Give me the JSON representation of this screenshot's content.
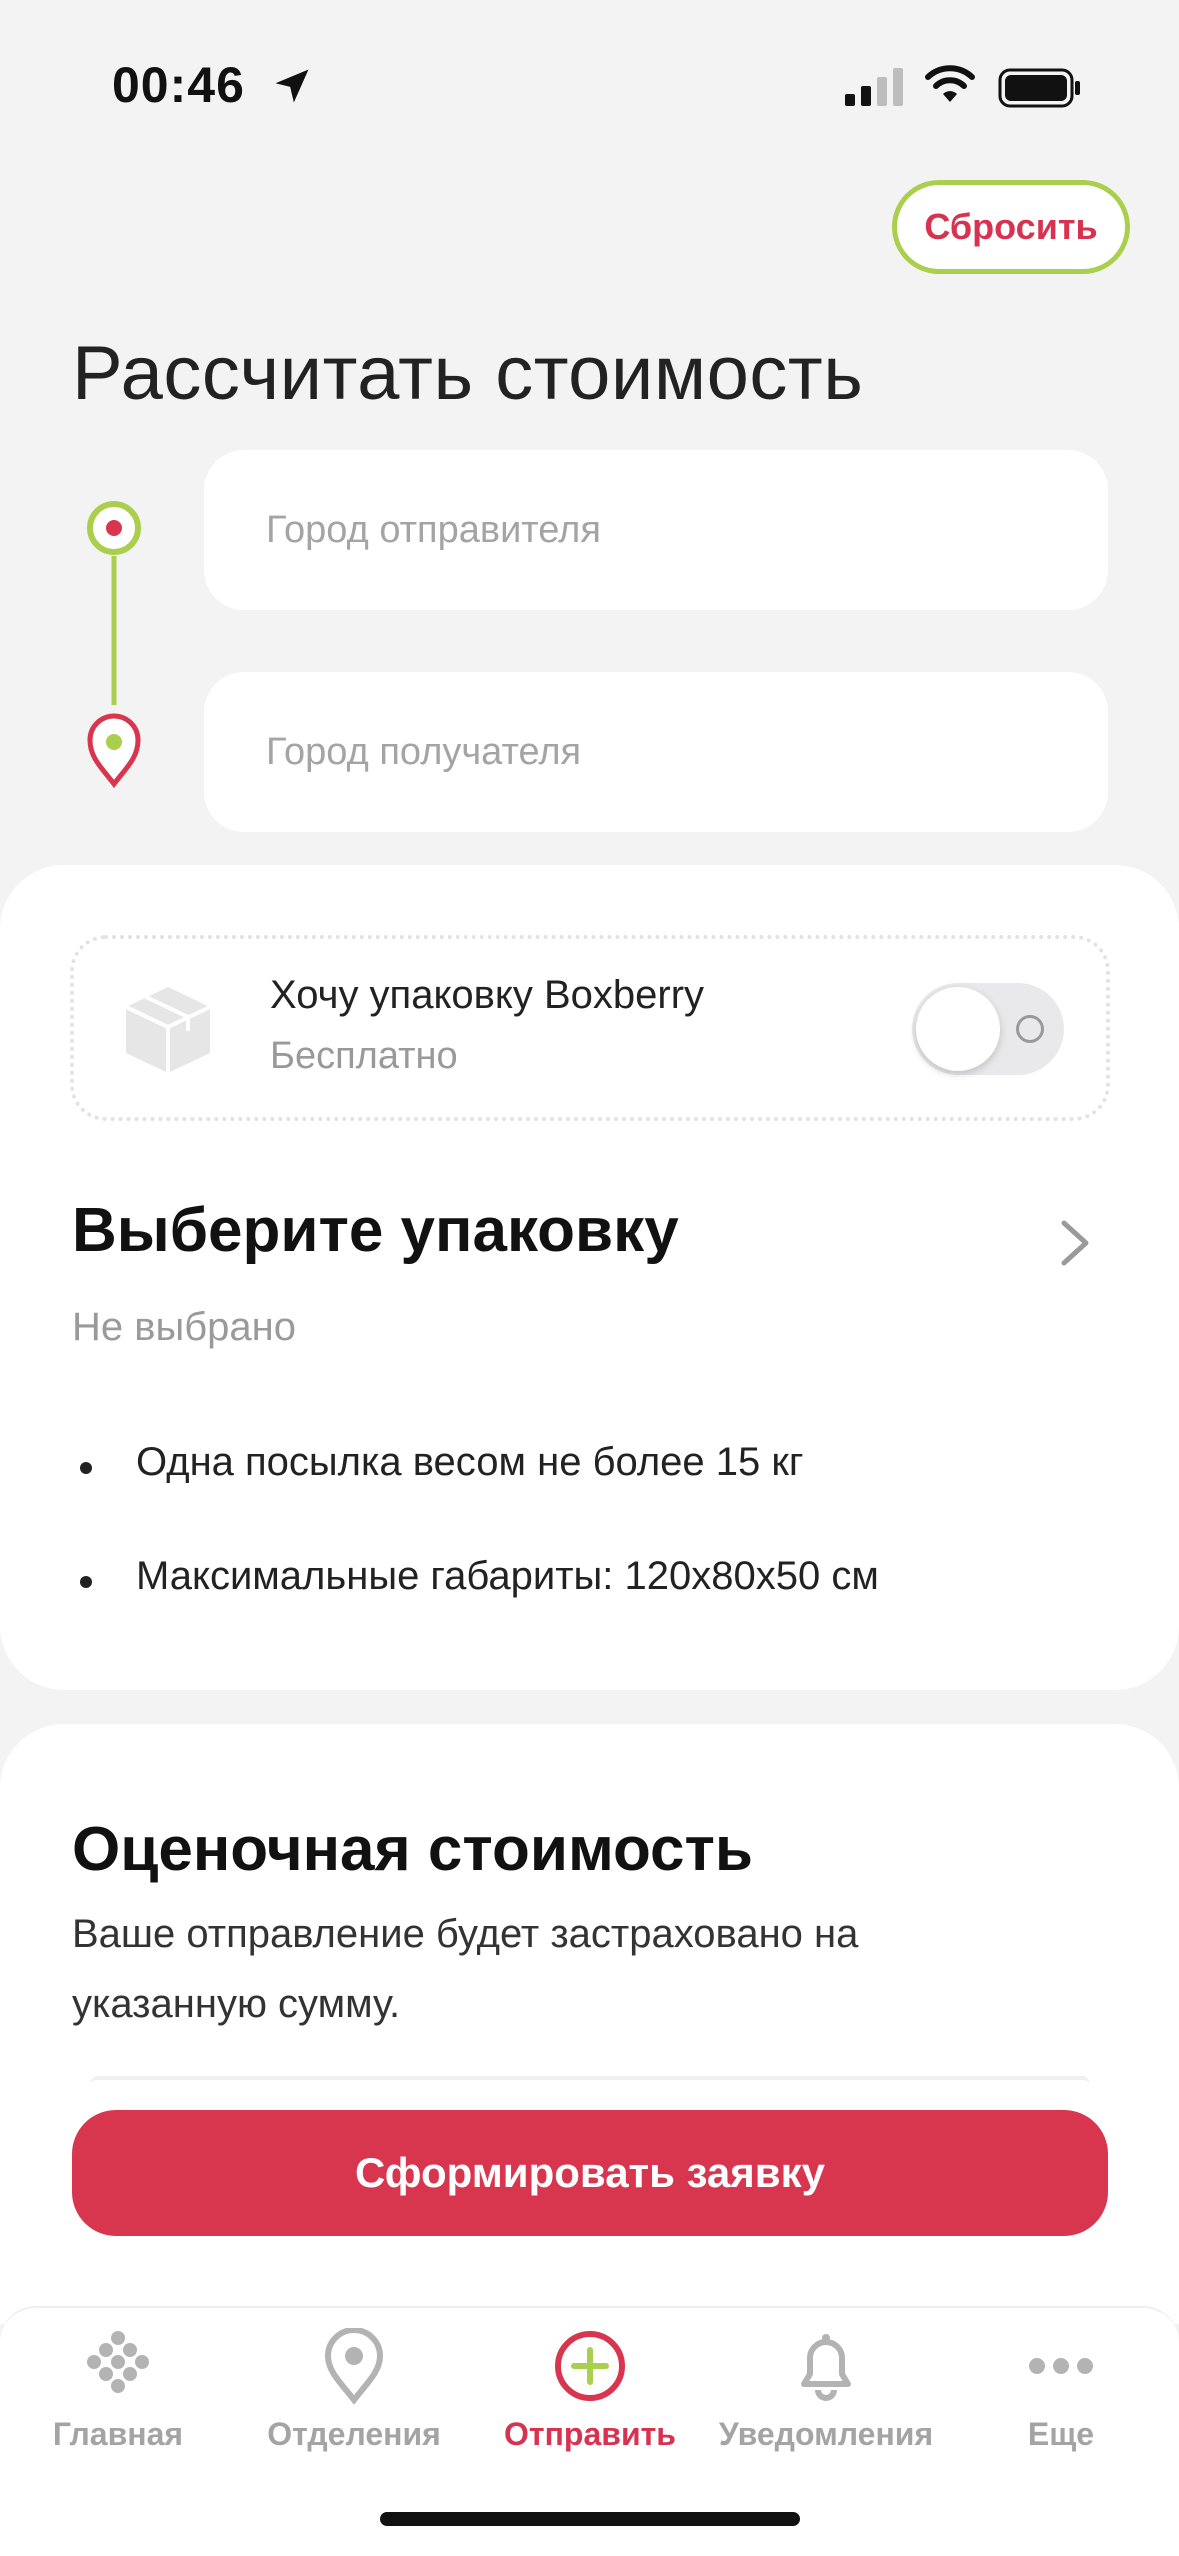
{
  "status_bar": {
    "time": "00:46"
  },
  "header": {
    "reset_label": "Сбросить",
    "title": "Рассчитать стоимость"
  },
  "route": {
    "from_placeholder": "Город отправителя",
    "to_placeholder": "Город получателя"
  },
  "packaging": {
    "toggle_title": "Хочу упаковку Boxberry",
    "toggle_subtitle": "Бесплатно",
    "toggle_on": false,
    "choose_title": "Выберите упаковку",
    "choose_value": "Не выбрано",
    "rules": [
      "Одна посылка весом не более 15 кг",
      "Максимальные габариты: 120x80x50 см"
    ]
  },
  "valuation": {
    "title": "Оценочная стоимость",
    "description": "Ваше отправление будет застраховано на указанную сумму."
  },
  "submit_label": "Сформировать заявку",
  "tab_bar": {
    "items": [
      {
        "label": "Главная",
        "icon": "home-icon",
        "active": false
      },
      {
        "label": "Отделения",
        "icon": "map-pin-icon",
        "active": false
      },
      {
        "label": "Отправить",
        "icon": "plus-circle-icon",
        "active": true
      },
      {
        "label": "Уведомления",
        "icon": "bell-icon",
        "active": false
      },
      {
        "label": "Еще",
        "icon": "more-icon",
        "active": false
      }
    ]
  },
  "colors": {
    "accent_red": "#d8354f",
    "accent_green": "#a9cf4d",
    "background": "#f3f3f3"
  }
}
